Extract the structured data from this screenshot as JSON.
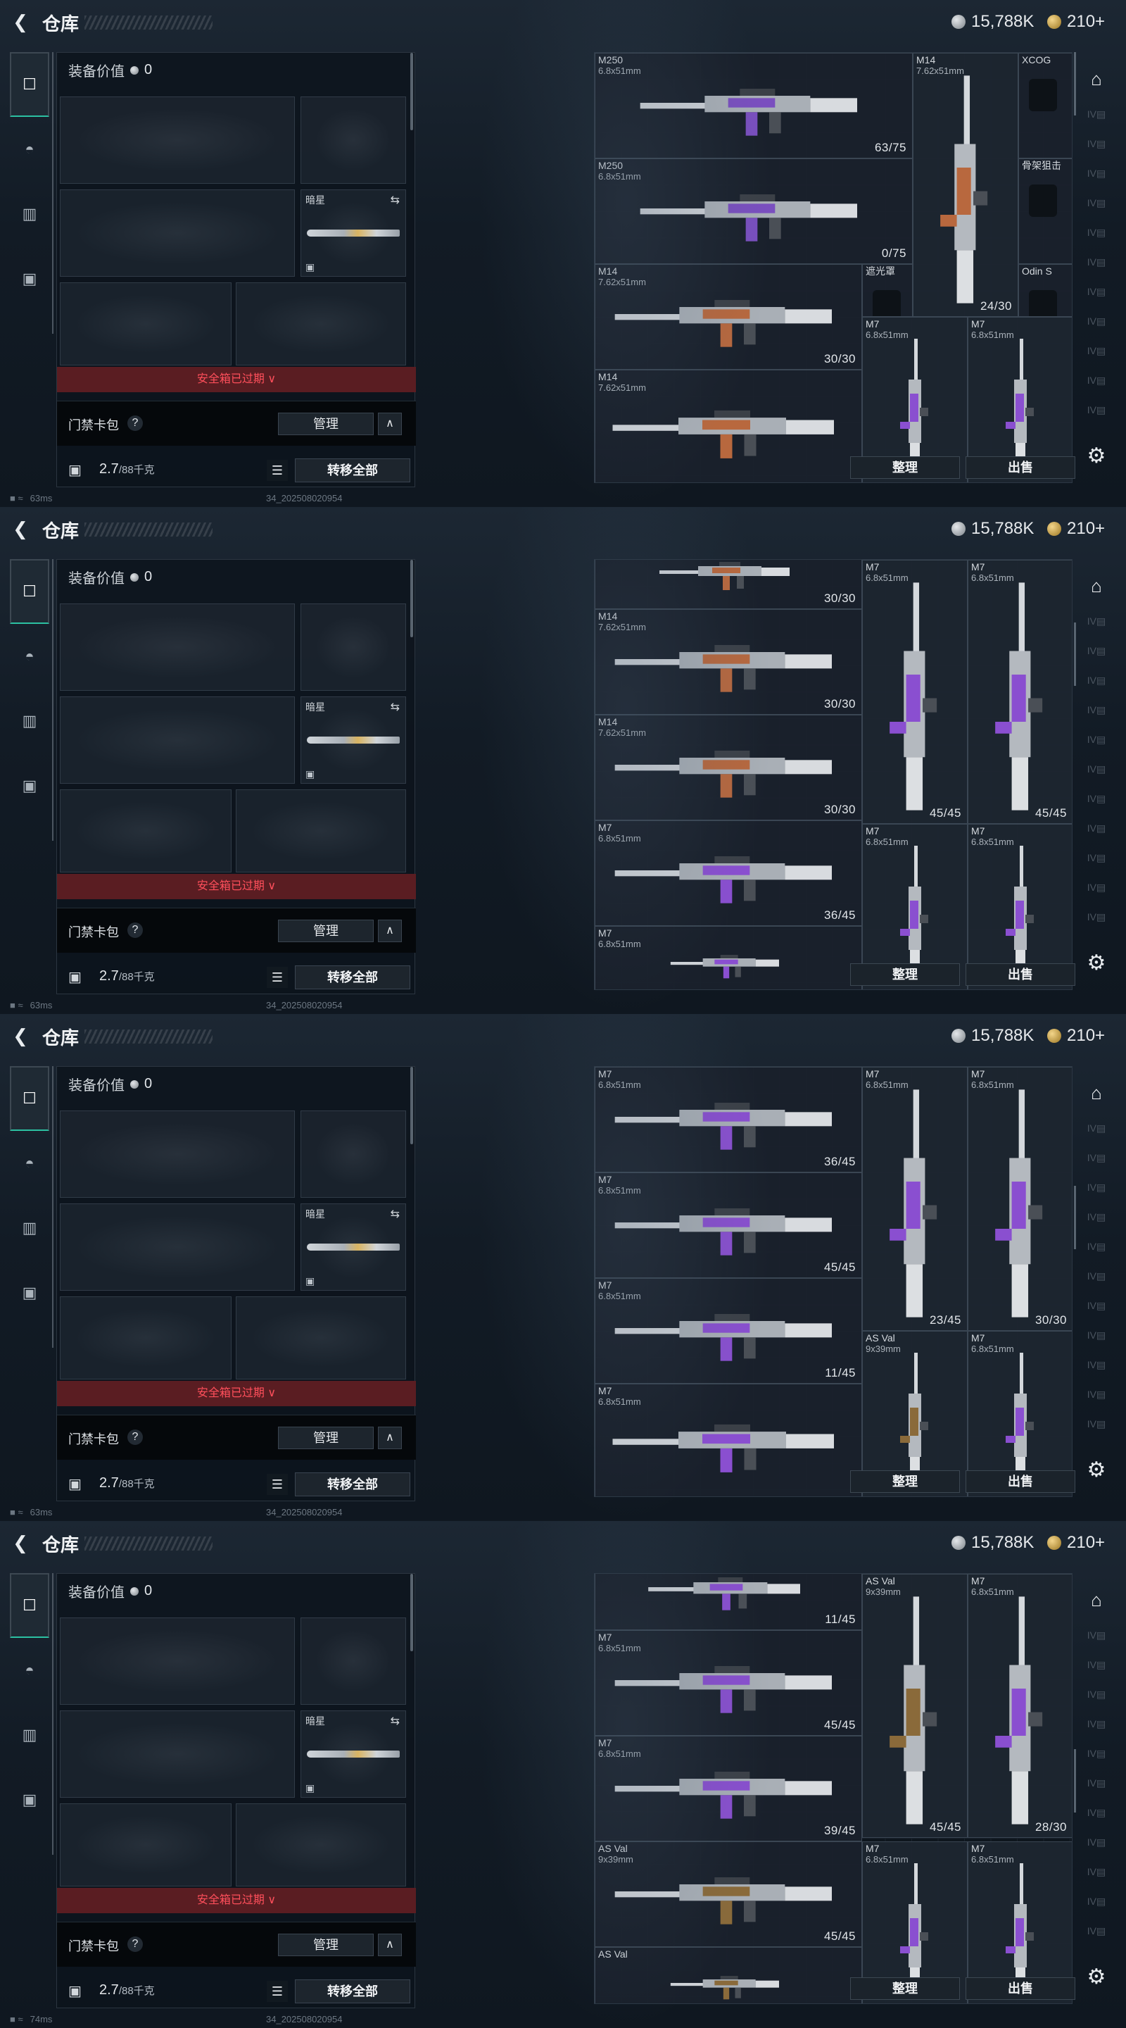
{
  "header": {
    "title": "仓库",
    "silver_amount": "15,788K",
    "gold_amount": "210+",
    "back_icon": "back-arrow-icon"
  },
  "categories": [
    {
      "icon": "pistol-icon",
      "active": true
    },
    {
      "icon": "helmet-icon",
      "active": false
    },
    {
      "icon": "vest-icon",
      "active": false
    },
    {
      "icon": "briefcase-icon",
      "active": false
    }
  ],
  "loadout": {
    "equip_value_label": "装备价值",
    "equip_value": "0",
    "melee_name": "暗星",
    "safebox_notice": "安全箱已过期",
    "card_pack_label": "门禁卡包",
    "manage_label": "管理",
    "weight_value": "2.7",
    "weight_max": "/88千克",
    "transfer_all_label": "转移全部"
  },
  "actions": {
    "sort_label": "整理",
    "sell_label": "出售"
  },
  "status": {
    "ping_frames": [
      "63ms",
      "63ms",
      "63ms",
      "74ms"
    ],
    "build_id": "34_202508020954"
  },
  "frames": [
    {
      "items": [
        {
          "name": "M250",
          "cal": "6.8x51mm",
          "ammo": "63/75",
          "color": "#7a4fbf"
        },
        {
          "name": "M250",
          "cal": "6.8x51mm",
          "ammo": "0/75",
          "color": "#7a4fbf"
        },
        {
          "name": "M14",
          "cal": "7.62x51mm",
          "ammo": "24/30",
          "color": "#b8683e"
        },
        {
          "name": "XCOG",
          "cal": "",
          "ammo": "",
          "color": ""
        },
        {
          "name": "骨架狙击",
          "cal": "",
          "ammo": "",
          "color": ""
        },
        {
          "name": "遮光罩",
          "cal": "",
          "ammo": "",
          "color": ""
        },
        {
          "name": "Odin S",
          "cal": "",
          "ammo": "",
          "color": ""
        },
        {
          "name": "M14",
          "cal": "7.62x51mm",
          "ammo": "30/30",
          "color": "#b8683e"
        },
        {
          "name": "M7",
          "cal": "6.8x51mm",
          "ammo": "",
          "color": "#8a4fd0"
        },
        {
          "name": "M7",
          "cal": "6.8x51mm",
          "ammo": "",
          "color": "#8a4fd0"
        },
        {
          "name": "M14",
          "cal": "7.62x51mm",
          "ammo": "",
          "color": "#b8683e"
        }
      ]
    },
    {
      "items": [
        {
          "name": "",
          "cal": "",
          "ammo": "30/30",
          "color": "#b8683e"
        },
        {
          "name": "M7",
          "cal": "6.8x51mm",
          "ammo": "45/45",
          "color": "#8a4fd0"
        },
        {
          "name": "M7",
          "cal": "6.8x51mm",
          "ammo": "45/45",
          "color": "#8a4fd0"
        },
        {
          "name": "M14",
          "cal": "7.62x51mm",
          "ammo": "30/30",
          "color": "#b8683e"
        },
        {
          "name": "M14",
          "cal": "7.62x51mm",
          "ammo": "30/30",
          "color": "#b8683e"
        },
        {
          "name": "M7",
          "cal": "6.8x51mm",
          "ammo": "36/45",
          "color": "#8a4fd0"
        },
        {
          "name": "M7",
          "cal": "6.8x51mm",
          "ammo": "",
          "color": "#8a4fd0"
        },
        {
          "name": "M7",
          "cal": "6.8x51mm",
          "ammo": "",
          "color": "#8a4fd0"
        },
        {
          "name": "M7",
          "cal": "6.8x51mm",
          "ammo": "",
          "color": "#8a4fd0"
        }
      ]
    },
    {
      "items": [
        {
          "name": "M7",
          "cal": "6.8x51mm",
          "ammo": "36/45",
          "color": "#8a4fd0"
        },
        {
          "name": "M7",
          "cal": "6.8x51mm",
          "ammo": "23/45",
          "color": "#8a4fd0"
        },
        {
          "name": "M7",
          "cal": "6.8x51mm",
          "ammo": "30/30",
          "color": "#8a4fd0"
        },
        {
          "name": "M7",
          "cal": "6.8x51mm",
          "ammo": "45/45",
          "color": "#8a4fd0"
        },
        {
          "name": "M7",
          "cal": "6.8x51mm",
          "ammo": "11/45",
          "color": "#8a4fd0"
        },
        {
          "name": "AS Val",
          "cal": "9x39mm",
          "ammo": "",
          "color": "#8a6a3a"
        },
        {
          "name": "M7",
          "cal": "6.8x51mm",
          "ammo": "",
          "color": "#8a4fd0"
        },
        {
          "name": "M7",
          "cal": "6.8x51mm",
          "ammo": "",
          "color": "#8a4fd0"
        }
      ]
    },
    {
      "items": [
        {
          "name": "",
          "cal": "",
          "ammo": "11/45",
          "color": "#8a4fd0"
        },
        {
          "name": "AS Val",
          "cal": "9x39mm",
          "ammo": "45/45",
          "color": "#8a6a3a"
        },
        {
          "name": "M7",
          "cal": "6.8x51mm",
          "ammo": "28/30",
          "color": "#8a4fd0"
        },
        {
          "name": "M7",
          "cal": "6.8x51mm",
          "ammo": "45/45",
          "color": "#8a4fd0"
        },
        {
          "name": "M7",
          "cal": "6.8x51mm",
          "ammo": "39/45",
          "color": "#8a4fd0"
        },
        {
          "name": "AS Val",
          "cal": "9x39mm",
          "ammo": "45/45",
          "color": "#8a6a3a"
        },
        {
          "name": "M7",
          "cal": "6.8x51mm",
          "ammo": "",
          "color": "#8a4fd0"
        },
        {
          "name": "M7",
          "cal": "6.8x51mm",
          "ammo": "",
          "color": "#8a4fd0"
        },
        {
          "name": "AS Val",
          "cal": "",
          "ammo": "",
          "color": "#8a6a3a"
        }
      ]
    }
  ]
}
